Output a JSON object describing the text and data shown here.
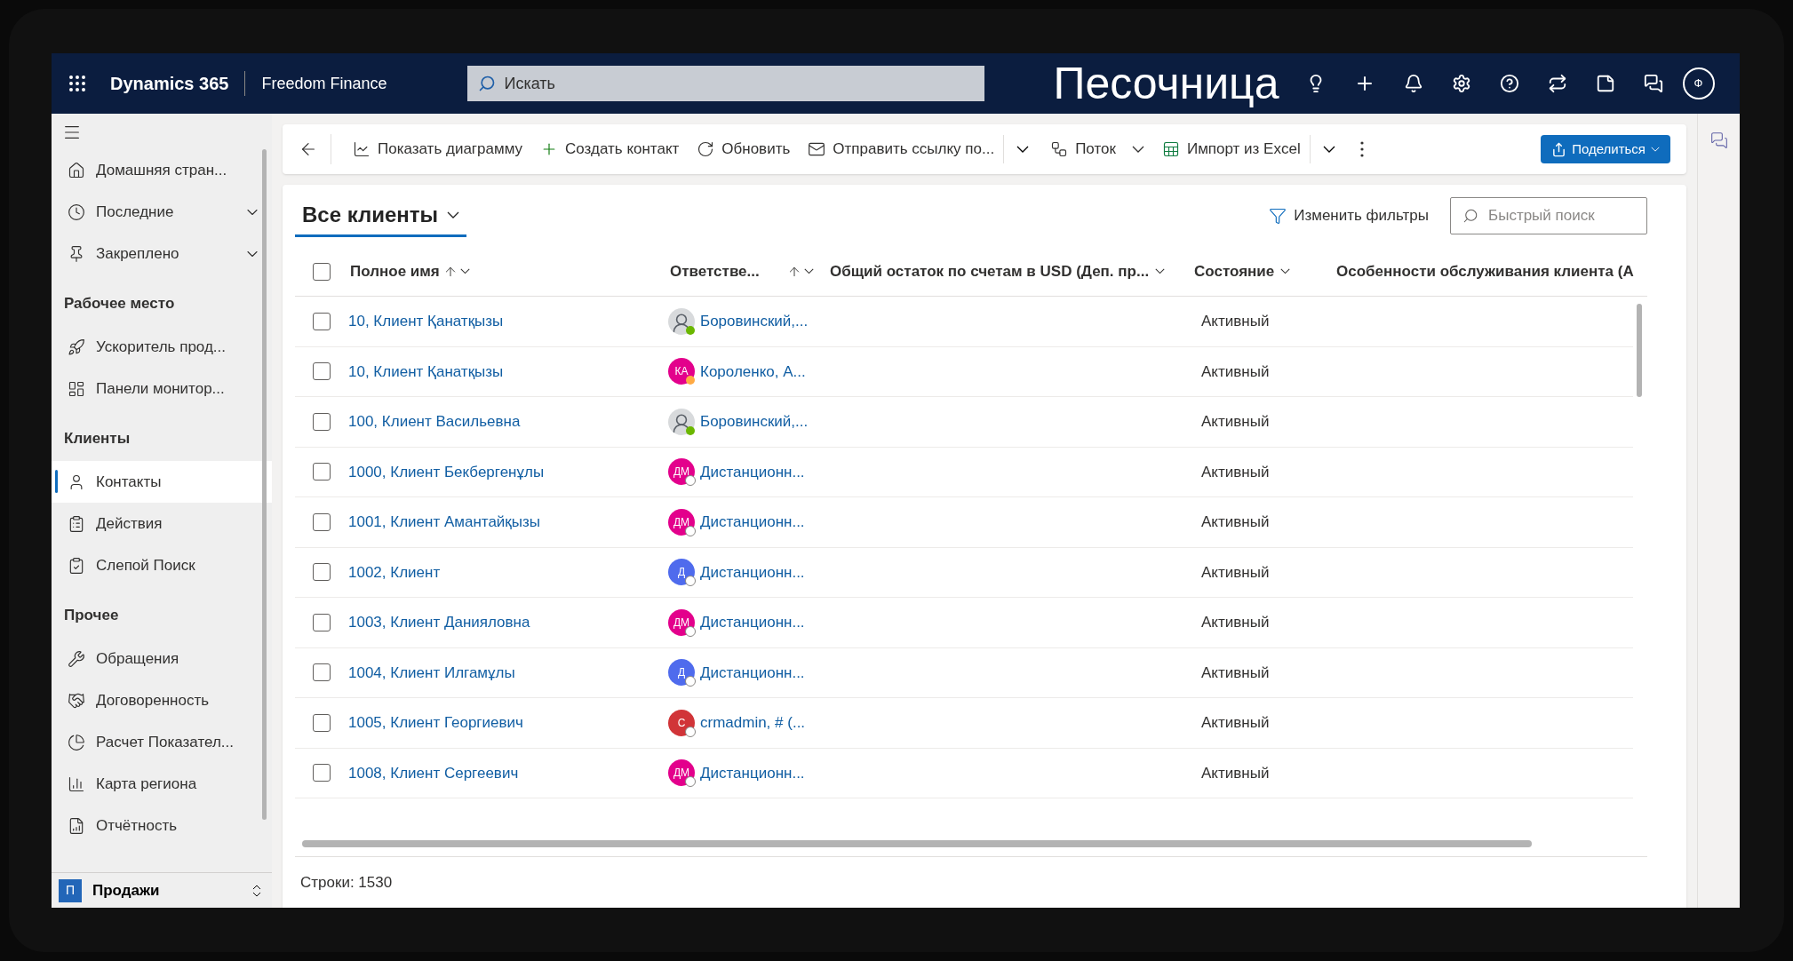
{
  "app": {
    "title": "Dynamics 365",
    "org": "Freedom Finance",
    "search_placeholder": "Искать",
    "environment": "Песочница",
    "user_initial": "Ф"
  },
  "sidebar": {
    "top_items": [
      {
        "label": "Домашняя стран...",
        "selected": false
      },
      {
        "label": "Последние",
        "selected": false,
        "expanded": false
      },
      {
        "label": "Закреплено",
        "selected": false,
        "expanded": false
      }
    ],
    "groups": [
      {
        "title": "Рабочее место",
        "items": [
          {
            "label": "Ускоритель прод...",
            "selected": false
          },
          {
            "label": "Панели монитор...",
            "selected": false
          }
        ]
      },
      {
        "title": "Клиенты",
        "items": [
          {
            "label": "Контакты",
            "selected": true
          },
          {
            "label": "Действия",
            "selected": false
          },
          {
            "label": "Слепой Поиск",
            "selected": false
          }
        ]
      },
      {
        "title": "Прочее",
        "items": [
          {
            "label": "Обращения",
            "selected": false
          },
          {
            "label": "Договоренность",
            "selected": false
          },
          {
            "label": "Расчет Показател...",
            "selected": false
          },
          {
            "label": "Карта региона",
            "selected": false
          },
          {
            "label": "Отчётность",
            "selected": false
          }
        ]
      }
    ],
    "area": {
      "initial": "П",
      "label": "Продажи"
    }
  },
  "command_bar": {
    "items": [
      {
        "kind": "button",
        "label": "Показать диаграмму"
      },
      {
        "kind": "button",
        "label": "Создать контакт"
      },
      {
        "kind": "button",
        "label": "Обновить"
      },
      {
        "kind": "button",
        "label": "Отправить ссылку по..."
      },
      {
        "kind": "split"
      },
      {
        "kind": "dropdown",
        "label": "Поток"
      },
      {
        "kind": "button",
        "label": "Импорт из Excel"
      },
      {
        "kind": "split"
      },
      {
        "kind": "more"
      }
    ],
    "share": "Поделиться"
  },
  "view": {
    "title": "Все клиенты",
    "filter": "Изменить фильтры",
    "quick_search_placeholder": "Быстрый поиск"
  },
  "table": {
    "header_checked": false,
    "columns": [
      {
        "label": "Полное имя",
        "sorted_ascending": true,
        "menu": true
      },
      {
        "label": "Ответстве...",
        "sorted_ascending": true,
        "menu": true
      },
      {
        "label": "Общий остаток по счетам в USD (Деп. пр...",
        "menu": true
      },
      {
        "label": "Состояние",
        "menu": true
      },
      {
        "label": "Особенности обслуживания клиента (А",
        "menu": false
      }
    ],
    "rows": [
      {
        "checked": false,
        "name": "10, Клиент Қанатқызы",
        "owner": {
          "name": "Боровинский,...",
          "kind": "photo",
          "presence": {
            "color": "#6bb700",
            "hollow": false
          }
        },
        "state": "Активный"
      },
      {
        "checked": false,
        "name": "10, Клиент Қанатқызы",
        "owner": {
          "name": "Короленко, А...",
          "kind": "initials",
          "initials": "КА",
          "color": "#e3008c",
          "presence": {
            "color": "#ffaa44",
            "hollow": false
          }
        },
        "state": "Активный"
      },
      {
        "checked": false,
        "name": "100, Клиент Васильевна",
        "owner": {
          "name": "Боровинский,...",
          "kind": "photo",
          "presence": {
            "color": "#6bb700",
            "hollow": false
          }
        },
        "state": "Активный"
      },
      {
        "checked": false,
        "name": "1000, Клиент Бекбергенұлы",
        "owner": {
          "name": "Дистанционн...",
          "kind": "initials",
          "initials": "ДМ",
          "color": "#e3008c",
          "presence": {
            "color": "#8a8886",
            "hollow": true
          }
        },
        "state": "Активный"
      },
      {
        "checked": false,
        "name": "1001, Клиент Амантайқызы",
        "owner": {
          "name": "Дистанционн...",
          "kind": "initials",
          "initials": "ДМ",
          "color": "#e3008c",
          "presence": {
            "color": "#8a8886",
            "hollow": true
          }
        },
        "state": "Активный"
      },
      {
        "checked": false,
        "name": "1002, Клиент",
        "owner": {
          "name": "Дистанционн...",
          "kind": "initials",
          "initials": "Д",
          "color": "#4f6bed",
          "presence": {
            "color": "#8a8886",
            "hollow": true
          }
        },
        "state": "Активный"
      },
      {
        "checked": false,
        "name": "1003, Клиент Данияловна",
        "owner": {
          "name": "Дистанционн...",
          "kind": "initials",
          "initials": "ДМ",
          "color": "#e3008c",
          "presence": {
            "color": "#8a8886",
            "hollow": true
          }
        },
        "state": "Активный"
      },
      {
        "checked": false,
        "name": "1004, Клиент Илгамұлы",
        "owner": {
          "name": "Дистанционн...",
          "kind": "initials",
          "initials": "Д",
          "color": "#4f6bed",
          "presence": {
            "color": "#8a8886",
            "hollow": true
          }
        },
        "state": "Активный"
      },
      {
        "checked": false,
        "name": "1005, Клиент Георгиевич",
        "owner": {
          "name": "crmadmin, # (...",
          "kind": "initials",
          "initials": "C",
          "color": "#d13438",
          "presence": {
            "color": "#8a8886",
            "hollow": true
          }
        },
        "state": "Активный"
      },
      {
        "checked": false,
        "name": "1008, Клиент Сергеевич",
        "owner": {
          "name": "Дистанционн...",
          "kind": "initials",
          "initials": "ДМ",
          "color": "#e3008c",
          "presence": {
            "color": "#8a8886",
            "hollow": true
          }
        },
        "state": "Активный"
      }
    ]
  },
  "footer": "Строки: 1530"
}
